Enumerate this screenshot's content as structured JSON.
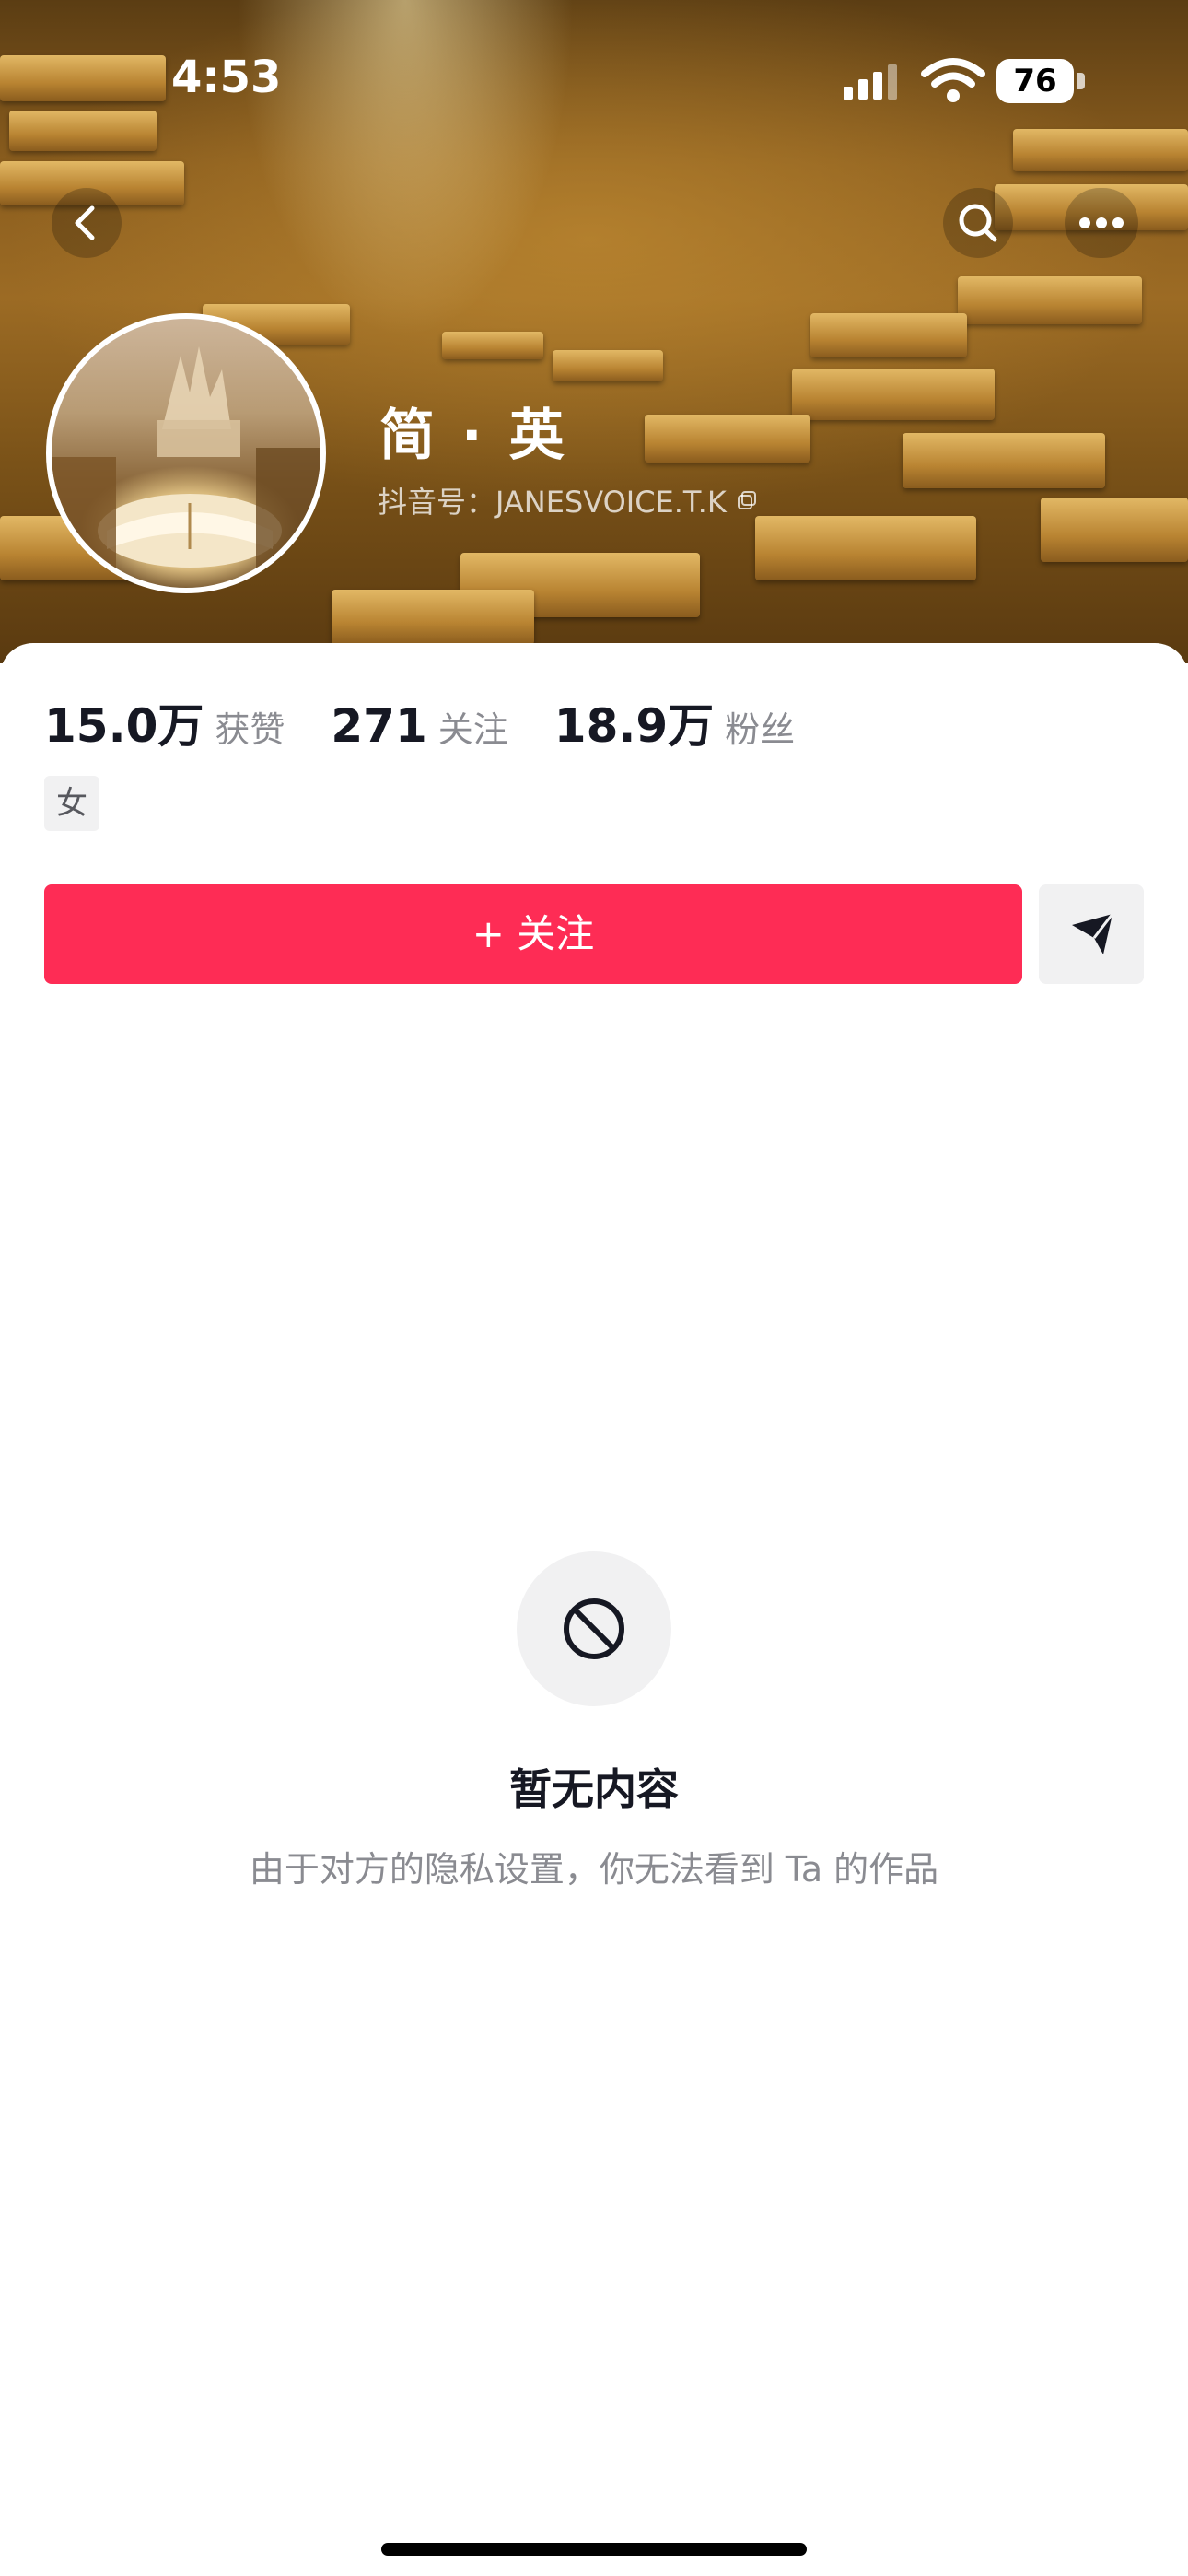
{
  "status_bar": {
    "time": "4:53",
    "battery": "76",
    "icons": [
      "signal-icon",
      "wifi-icon",
      "battery-icon"
    ]
  },
  "top_bar": {
    "icons": [
      "back-icon",
      "search-icon",
      "more-icon"
    ]
  },
  "profile": {
    "name": "简 · 英",
    "douyin_id": "抖音号：JANESVOICE.T.K",
    "gender_tag": "女"
  },
  "stats": [
    {
      "value": "15.0万",
      "label": "获赞"
    },
    {
      "value": "271",
      "label": "关注"
    },
    {
      "value": "18.9万",
      "label": "粉丝"
    }
  ],
  "actions": {
    "follow_label": "+ 关注",
    "share_icon": "send-icon"
  },
  "empty_state": {
    "icon": "prohibited-icon",
    "title": "暂无内容",
    "subtitle": "由于对方的隐私设置，你无法看到 Ta 的作品"
  },
  "colors": {
    "accent": "#fe2c55",
    "text_primary": "#161823",
    "text_secondary": "#8a8b91"
  }
}
